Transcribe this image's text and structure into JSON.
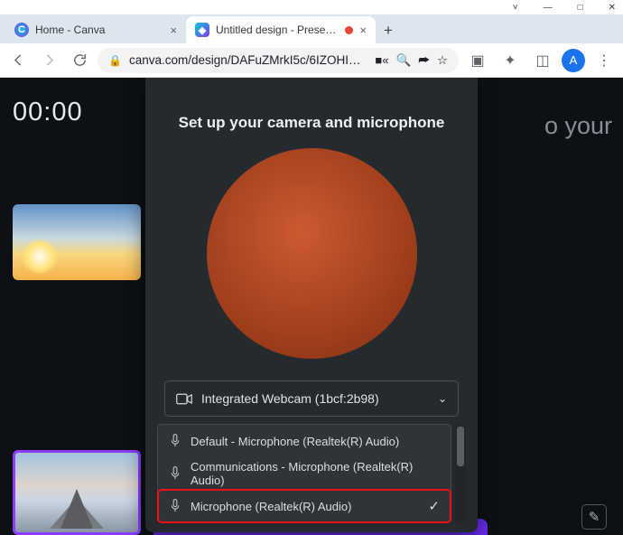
{
  "window_controls": {
    "min": "—",
    "max": "□",
    "close": "✕",
    "down": "˅"
  },
  "tabs": [
    {
      "title": "Home - Canva",
      "favicon": "C"
    },
    {
      "title": "Untitled design - Presentation",
      "favicon": "◈"
    }
  ],
  "new_tab_glyph": "+",
  "nav": {
    "back": "←",
    "forward": "→",
    "reload": "⟳"
  },
  "url": "canva.com/design/DAFuZMrkI5c/6IZOHI…",
  "toolbar_icons": {
    "cam": "🎥",
    "zoom": "⊕",
    "share": "↗",
    "star": "☆",
    "reader": "▣",
    "ext": "✦",
    "side": "◫",
    "avatar": "A",
    "menu": "⋮"
  },
  "app": {
    "timer": "00:00",
    "side_text": "o your",
    "dialog_title": "Set up your camera and microphone",
    "camera": {
      "label": "Integrated Webcam (1bcf:2b98)"
    },
    "mic_options": [
      {
        "label": "Default - Microphone (Realtek(R) Audio)",
        "selected": false
      },
      {
        "label": "Communications - Microphone (Realtek(R) Audio)",
        "selected": false
      },
      {
        "label": "Microphone (Realtek(R) Audio)",
        "selected": true
      }
    ],
    "edit_glyph": "✎"
  }
}
